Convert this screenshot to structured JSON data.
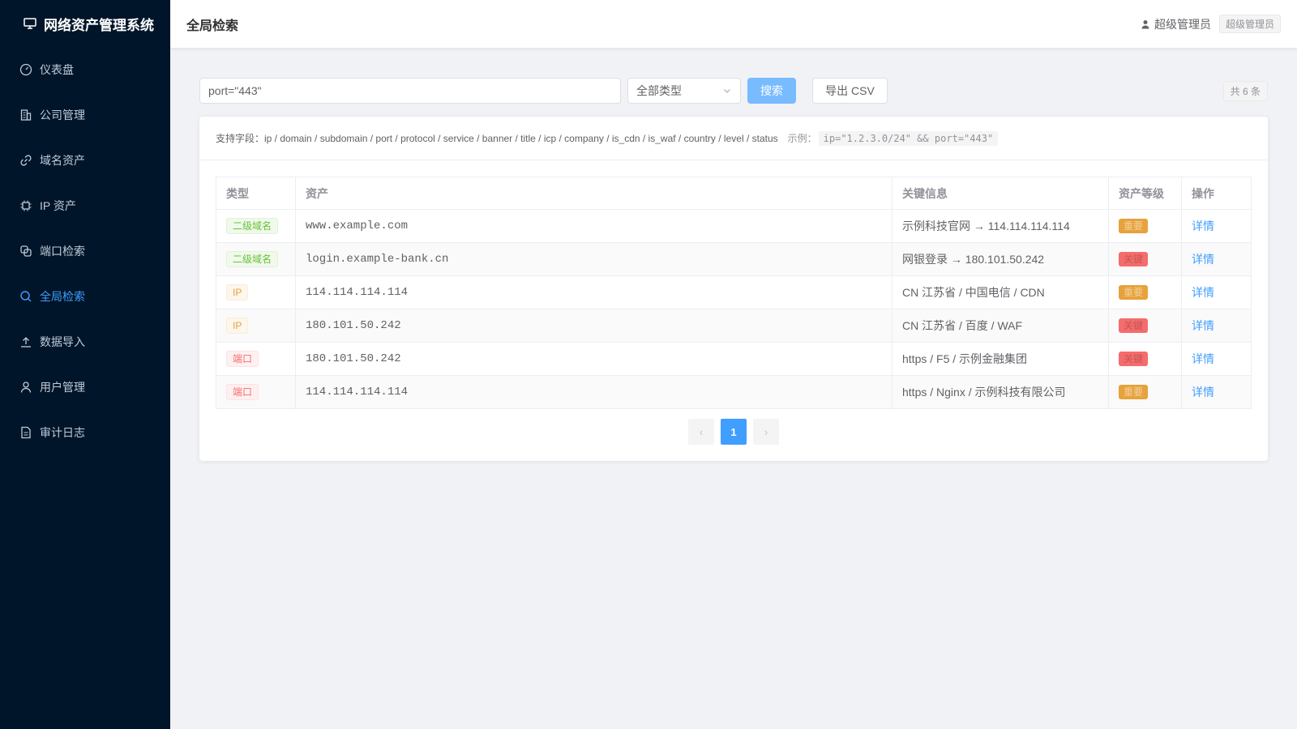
{
  "app": {
    "title": "网络资产管理系统",
    "icon": "monitor-icon"
  },
  "sidebar": {
    "items": [
      {
        "label": "仪表盘",
        "icon": "dashboard-icon",
        "active": false
      },
      {
        "label": "公司管理",
        "icon": "building-icon",
        "active": false
      },
      {
        "label": "域名资产",
        "icon": "link-icon",
        "active": false
      },
      {
        "label": "IP 资产",
        "icon": "chip-icon",
        "active": false
      },
      {
        "label": "端口检索",
        "icon": "connection-icon",
        "active": false
      },
      {
        "label": "全局检索",
        "icon": "search-icon",
        "active": true
      },
      {
        "label": "数据导入",
        "icon": "upload-icon",
        "active": false
      },
      {
        "label": "用户管理",
        "icon": "user-icon",
        "active": false
      },
      {
        "label": "审计日志",
        "icon": "document-icon",
        "active": false
      }
    ]
  },
  "header": {
    "title": "全局检索",
    "user_name": "超级管理员",
    "role_tag": "超级管理员"
  },
  "toolbar": {
    "query_value": "port=\"443\"",
    "type_select": "全部类型",
    "search_label": "搜索",
    "export_label": "导出 CSV",
    "count_text": "共 6 条"
  },
  "hint": {
    "fields_text": "支持字段：ip / domain / subdomain / port / protocol / service / banner / title / icp / company / is_cdn / is_waf / country / level / status",
    "example_label": "示例：",
    "example_code": "ip=\"1.2.3.0/24\" && port=\"443\""
  },
  "table": {
    "columns": [
      "类型",
      "资产",
      "关键信息",
      "资产等级",
      "操作"
    ],
    "rows": [
      {
        "type": "二级域名",
        "type_color": "green",
        "asset": "www.example.com",
        "info": "示例科技官网 → 114.114.114.114",
        "level": "重要",
        "level_color": "orange",
        "action": "详情"
      },
      {
        "type": "二级域名",
        "type_color": "green",
        "asset": "login.example-bank.cn",
        "info": "网银登录 → 180.101.50.242",
        "level": "关键",
        "level_color": "red",
        "action": "详情"
      },
      {
        "type": "IP",
        "type_color": "orange",
        "asset": "114.114.114.114",
        "info": "CN 江苏省 / 中国电信 / CDN",
        "level": "重要",
        "level_color": "orange",
        "action": "详情"
      },
      {
        "type": "IP",
        "type_color": "orange",
        "asset": "180.101.50.242",
        "info": "CN 江苏省 / 百度 / WAF",
        "level": "关键",
        "level_color": "red",
        "action": "详情"
      },
      {
        "type": "端口",
        "type_color": "red",
        "asset": "180.101.50.242",
        "info": "https / F5 / 示例金融集团",
        "level": "关键",
        "level_color": "red",
        "action": "详情"
      },
      {
        "type": "端口",
        "type_color": "red",
        "asset": "114.114.114.114",
        "info": "https / Nginx / 示例科技有限公司",
        "level": "重要",
        "level_color": "orange",
        "action": "详情"
      }
    ]
  },
  "pagination": {
    "prev": "‹",
    "current": "1",
    "next": "›"
  }
}
